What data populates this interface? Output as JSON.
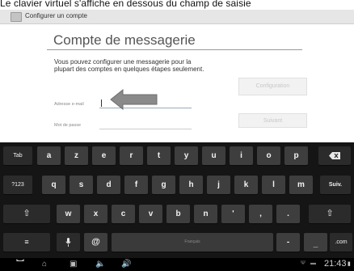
{
  "caption": "Le clavier virtuel s'affiche en dessous du champ de saisie",
  "app": {
    "title": "Configurer un compte"
  },
  "form": {
    "heading": "Compte de messagerie",
    "description": "Vous pouvez configurer une messagerie pour la plupart des comptes en quelques étapes seulement.",
    "email_label": "Adresse e-mail",
    "email_value": "",
    "password_label": "Mot de passe",
    "password_value": "",
    "config_button": "Configuration",
    "next_button": "Suivant"
  },
  "keyboard": {
    "row1": [
      "a",
      "z",
      "e",
      "r",
      "t",
      "y",
      "u",
      "i",
      "o",
      "p"
    ],
    "row2": [
      "q",
      "s",
      "d",
      "f",
      "g",
      "h",
      "j",
      "k",
      "l",
      "m"
    ],
    "row3": [
      "w",
      "x",
      "c",
      "v",
      "b",
      "n",
      "'",
      ",",
      "."
    ],
    "tab_label": "Tab",
    "numbers_label": "?123",
    "enter_label": "Suiv.",
    "at_label": "@",
    "space_label": "Français",
    "dash_label": "-",
    "underscore_label": "_",
    "com_label": ".com"
  },
  "status": {
    "time": "21:43"
  },
  "icons": {
    "app": "email-app-icon",
    "arrow": "left-arrow-annotation-icon",
    "backspace": "backspace-icon",
    "shift": "shift-icon",
    "settings": "keyboard-settings-icon",
    "mic": "microphone-icon",
    "back": "back-icon",
    "home": "home-icon",
    "recent": "recent-apps-icon",
    "volume_down": "volume-down-icon",
    "volume_up": "volume-up-icon",
    "usb": "usb-icon",
    "battery": "battery-icon"
  }
}
